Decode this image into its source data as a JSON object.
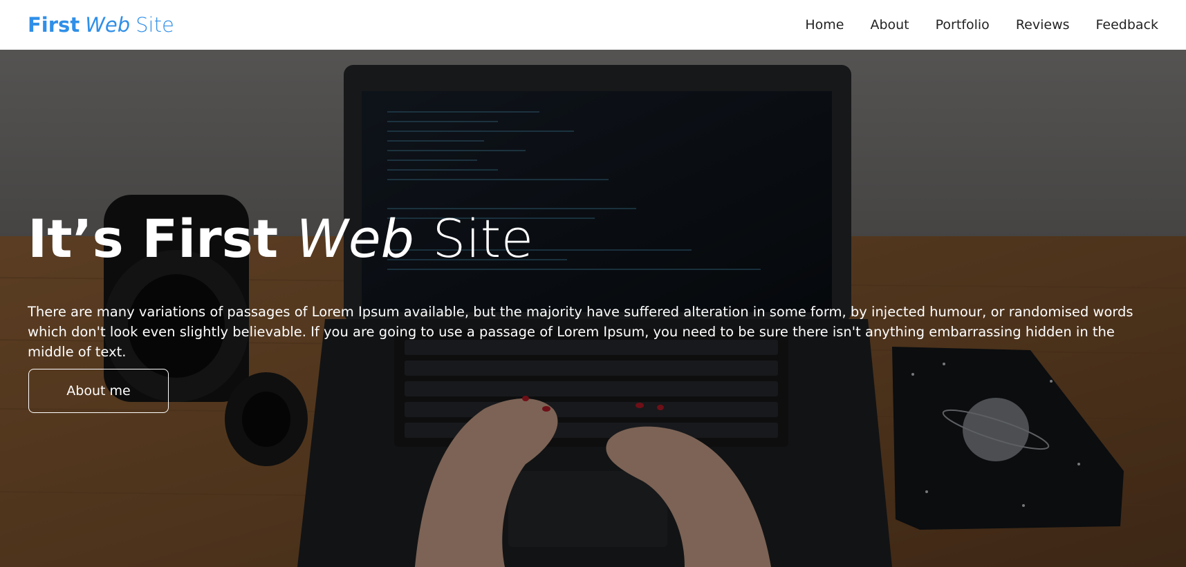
{
  "brand": {
    "first": "First",
    "web": "Web",
    "site": "Site"
  },
  "nav": {
    "items": [
      {
        "label": "Home"
      },
      {
        "label": "About"
      },
      {
        "label": "Portfolio"
      },
      {
        "label": "Reviews"
      },
      {
        "label": "Feedback"
      }
    ]
  },
  "hero": {
    "title": {
      "part1": "It’s",
      "part2": "First",
      "part3": "Web",
      "part4": "Site"
    },
    "text": "There are many variations of passages of Lorem Ipsum available, but the majority have suffered alteration in some form, by injected humour, or randomised words which don't look even slightly believable. If you are going to use a passage of Lorem Ipsum, you need to be sure there isn't anything embarrassing hidden in the middle of text.",
    "button_label": "About me",
    "background_image": "photo of hands typing on a laptop on a wooden desk with a camera lens and a notebook"
  },
  "colors": {
    "brand": "#2f8fe8",
    "nav_text": "#222222",
    "hero_text": "#ffffff"
  }
}
